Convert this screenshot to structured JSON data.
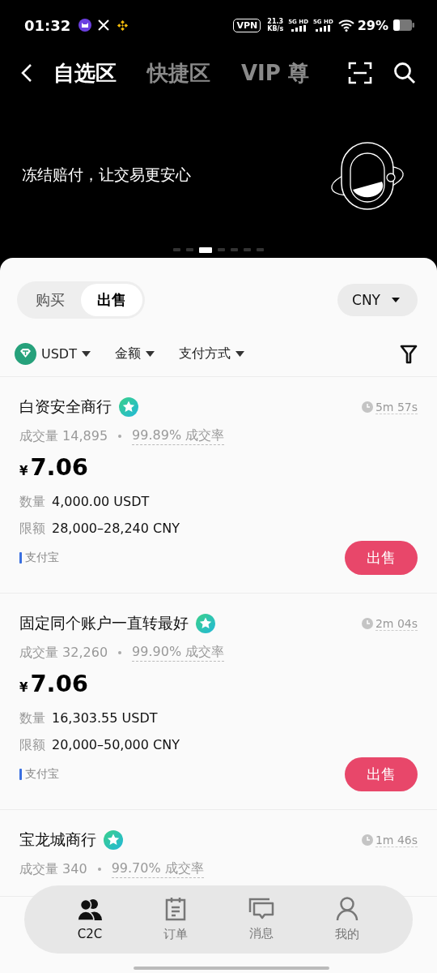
{
  "status_bar": {
    "time": "01:32",
    "vpn": "VPN",
    "speed": "21.3",
    "speed_unit": "KB/s",
    "sim_1": "5G HD",
    "sim_2": "5G HD",
    "battery": "29%"
  },
  "header": {
    "tabs": [
      {
        "label": "自选区",
        "selected": true
      },
      {
        "label": "快捷区",
        "selected": false
      },
      {
        "label": "VIP 尊",
        "selected": false
      }
    ]
  },
  "banner": {
    "text": "冻结赔付，让交易更安心",
    "dots": [
      {
        "selected": false
      },
      {
        "selected": false
      },
      {
        "selected": true
      },
      {
        "selected": false
      },
      {
        "selected": false
      },
      {
        "selected": false
      },
      {
        "selected": false
      }
    ]
  },
  "side_toggle": [
    {
      "label": "购买",
      "selected": false
    },
    {
      "label": "出售",
      "selected": true
    }
  ],
  "currency": "CNY",
  "filters": {
    "coin": "USDT",
    "amount": "金额",
    "payment": "支付方式"
  },
  "ads": [
    {
      "merchant": "白资安全商行",
      "time": "5m 57s",
      "volume_label": "成交量",
      "volume": "14,895",
      "rate": "99.89% 成交率",
      "currency_sign": "¥",
      "price": "7.06",
      "qty_label": "数量",
      "qty": "4,000.00 USDT",
      "limit_label": "限额",
      "limit": "28,000–28,240 CNY",
      "payment": "支付宝",
      "action": "出售"
    },
    {
      "merchant": "固定同个账户一直转最好",
      "time": "2m 04s",
      "volume_label": "成交量",
      "volume": "32,260",
      "rate": "99.90% 成交率",
      "currency_sign": "¥",
      "price": "7.06",
      "qty_label": "数量",
      "qty": "16,303.55 USDT",
      "limit_label": "限额",
      "limit": "20,000–50,000 CNY",
      "payment": "支付宝",
      "action": "出售"
    },
    {
      "merchant": "宝龙城商行",
      "time": "1m 46s",
      "volume_label": "成交量",
      "volume": "340",
      "rate": "99.70% 成交率"
    }
  ],
  "bottom_nav": [
    {
      "label": "C2C",
      "selected": true
    },
    {
      "label": "订单",
      "selected": false
    },
    {
      "label": "消息",
      "selected": false
    },
    {
      "label": "我的",
      "selected": false
    }
  ]
}
